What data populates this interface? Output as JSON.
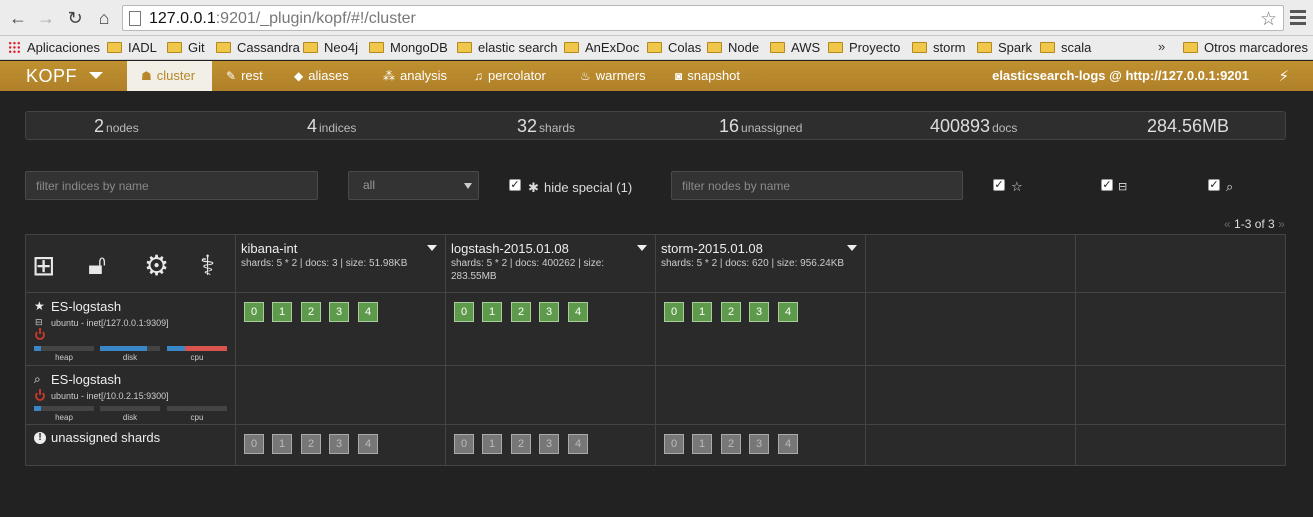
{
  "browser": {
    "url_host": "127.0.0.1",
    "url_rest": ":9201/_plugin/kopf/#!/cluster",
    "bookmarks": [
      "Aplicaciones",
      "IADL",
      "Git",
      "Cassandra",
      "Neo4j",
      "MongoDB",
      "elastic search",
      "AnExDoc",
      "Colas",
      "Node",
      "AWS",
      "Proyecto",
      "storm",
      "Spark",
      "scala"
    ],
    "more": "»",
    "other_bookmarks": "Otros marcadores"
  },
  "nav": {
    "brand": "KOPF",
    "items": [
      {
        "label": "cluster",
        "icon": "☗"
      },
      {
        "label": "rest",
        "icon": "✎"
      },
      {
        "label": "aliases",
        "icon": "◆"
      },
      {
        "label": "analysis",
        "icon": "⁂"
      },
      {
        "label": "percolator",
        "icon": "♫"
      },
      {
        "label": "warmers",
        "icon": "♨"
      },
      {
        "label": "snapshot",
        "icon": "◙"
      }
    ],
    "cluster_name": "elasticsearch-logs @ http://127.0.0.1:9201"
  },
  "stats": {
    "nodes": {
      "n": "2",
      "l": "nodes"
    },
    "indices": {
      "n": "4",
      "l": "indices"
    },
    "shards": {
      "n": "32",
      "l": "shards"
    },
    "unassigned": {
      "n": "16",
      "l": "unassigned"
    },
    "docs": {
      "n": "400893",
      "l": "docs"
    },
    "size": {
      "n": "284.56MB",
      "l": ""
    }
  },
  "filters": {
    "indices_placeholder": "filter indices by name",
    "select_value": "all",
    "hide_special": "hide special (1)",
    "nodes_placeholder": "filter nodes by name",
    "pager": "1-3 of 3",
    "prev": "«",
    "next": "»"
  },
  "indices": [
    {
      "name": "kibana-int",
      "meta": "shards: 5 * 2 | docs: 3 | size: 51.98KB"
    },
    {
      "name": "logstash-2015.01.08",
      "meta": "shards: 5 * 2 | docs: 400262 | size: 283.55MB"
    },
    {
      "name": "storm-2015.01.08",
      "meta": "shards: 5 * 2 | docs: 620 | size: 956.24KB"
    }
  ],
  "nodes": [
    {
      "name": "ES-logstash",
      "host": "ubuntu - inet[/127.0.0.1:9309]",
      "heap": 0.12,
      "disk": 0.78,
      "cpu": 0.7
    },
    {
      "name": "ES-logstash",
      "host": "ubuntu - inet[/10.0.2.15:9300]",
      "heap": 0.12,
      "disk": 0.0,
      "cpu": 0.0
    }
  ],
  "bar_labels": {
    "heap": "heap",
    "disk": "disk",
    "cpu": "cpu"
  },
  "unassigned_label": "unassigned shards",
  "shard_ids": [
    "0",
    "1",
    "2",
    "3",
    "4"
  ],
  "colors": {
    "accent": "#b8872b",
    "shard_ok": "#5e9a4b",
    "shard_unassigned": "#777777",
    "heap": "#3a87c8",
    "cpu": "#d9534f"
  }
}
